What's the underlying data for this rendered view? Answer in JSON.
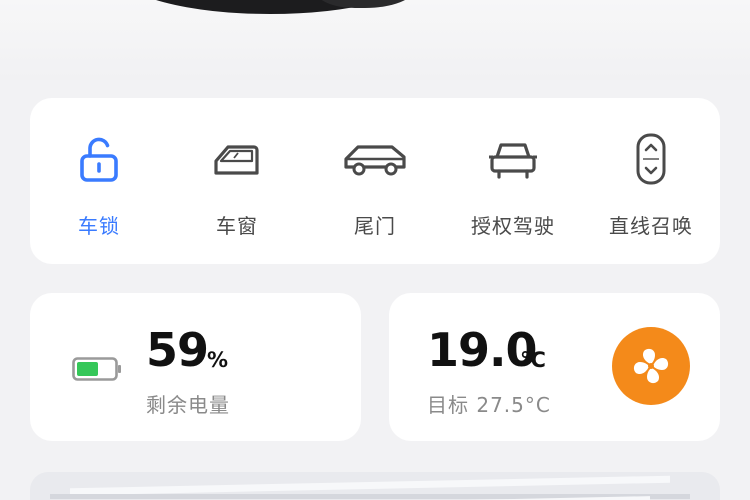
{
  "controls": [
    {
      "label": "车锁",
      "icon": "unlock-icon",
      "active": true
    },
    {
      "label": "车窗",
      "icon": "car-window-icon",
      "active": false
    },
    {
      "label": "尾门",
      "icon": "tailgate-icon",
      "active": false
    },
    {
      "label": "授权驾驶",
      "icon": "authorized-driving-icon",
      "active": false
    },
    {
      "label": "直线召唤",
      "icon": "summon-icon",
      "active": false
    }
  ],
  "battery": {
    "value": "59",
    "unit": "%",
    "label": "剩余电量",
    "level": 0.59,
    "color": "#35c759"
  },
  "climate": {
    "value": "19.0",
    "unit": "°C",
    "target": "目标 27.5°C",
    "fan_icon": "fan-icon",
    "fan_color": "#f48a1a"
  },
  "colors": {
    "accent": "#3a7bff",
    "background": "#f2f2f4"
  }
}
